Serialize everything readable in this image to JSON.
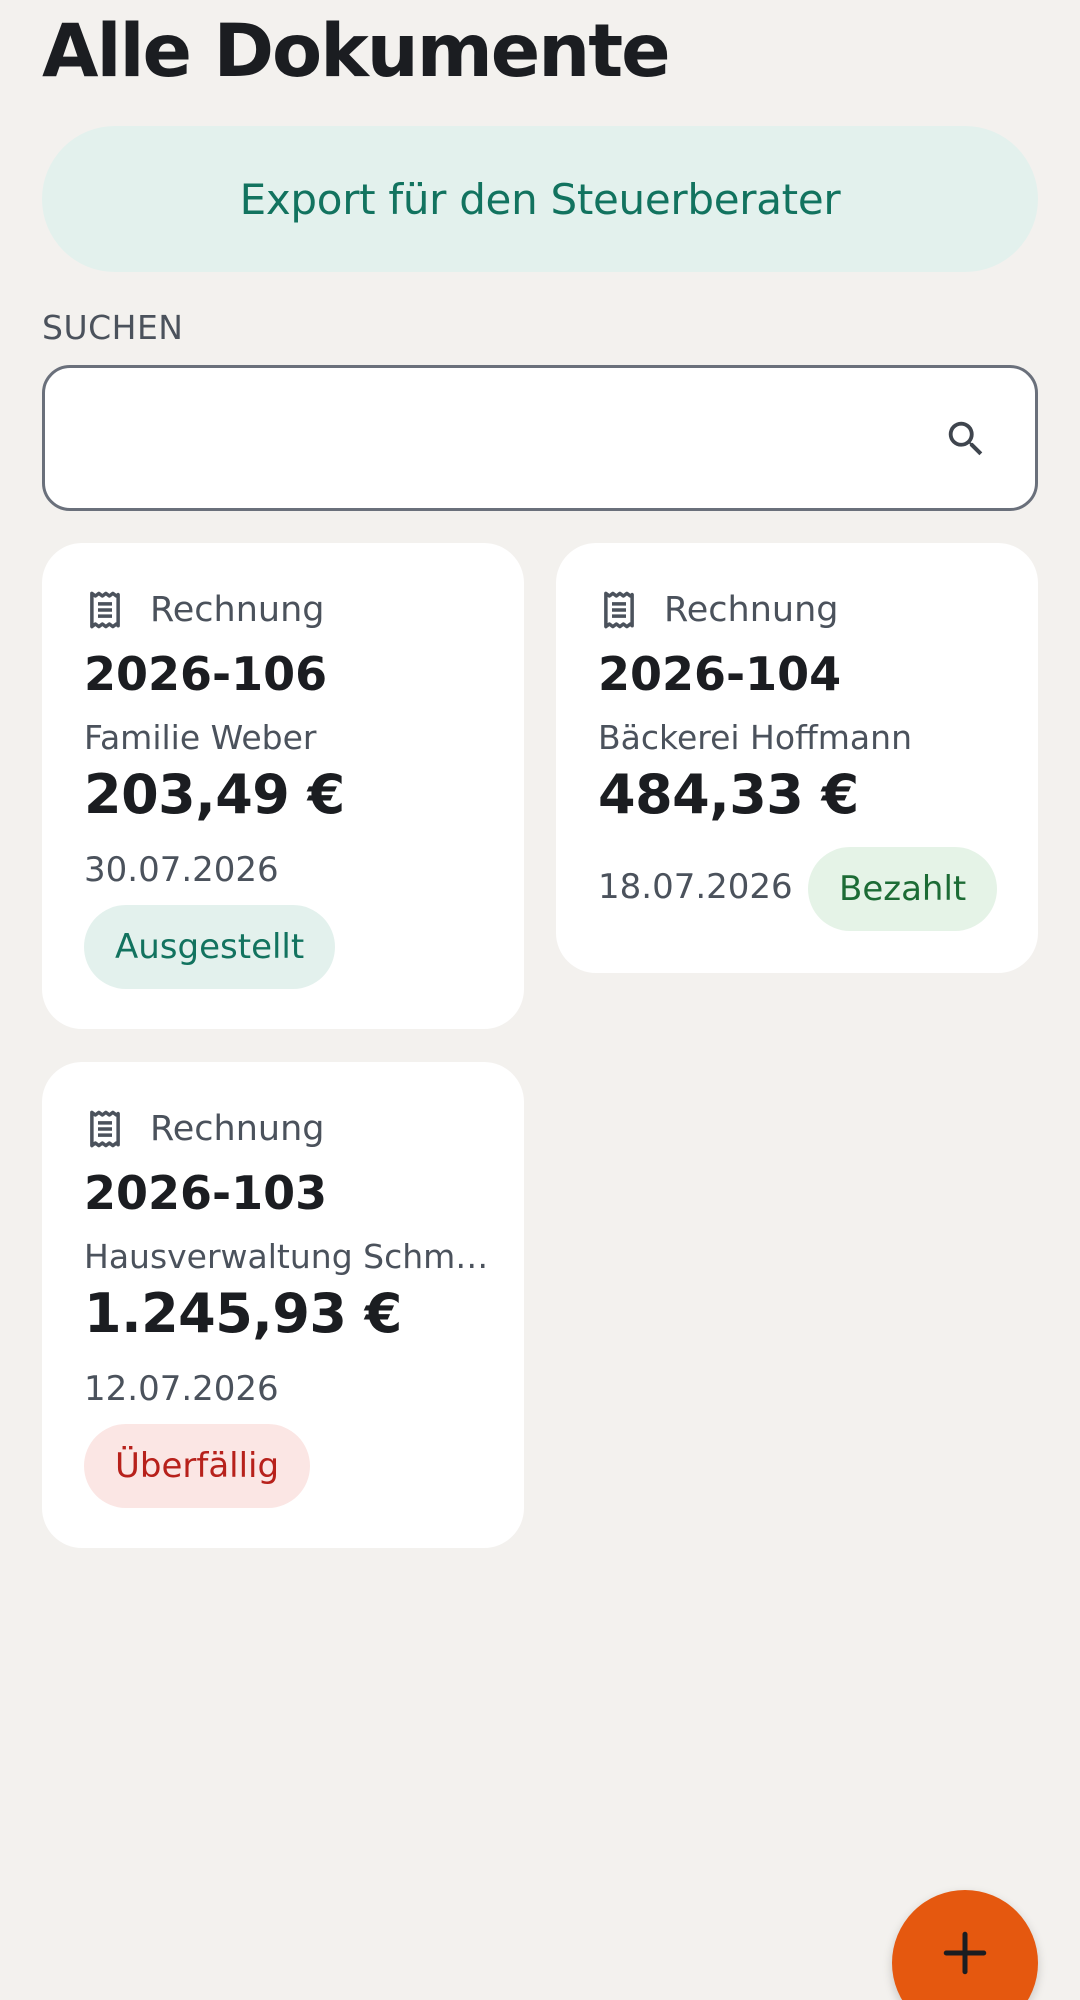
{
  "header": {
    "title": "Alle Dokumente"
  },
  "export": {
    "label": "Export für den Steuerberater"
  },
  "search": {
    "label": "SUCHEN",
    "value": "",
    "placeholder": ""
  },
  "documents": [
    {
      "type": "Rechnung",
      "number": "2026-106",
      "customer": "Familie Weber",
      "amount": "203,49 €",
      "date": "30.07.2026",
      "status": "Ausgestellt"
    },
    {
      "type": "Rechnung",
      "number": "2026-104",
      "customer": "Bäckerei Hoffmann",
      "amount": "484,33 €",
      "date": "18.07.2026",
      "status": "Bezahlt"
    },
    {
      "type": "Rechnung",
      "number": "2026-103",
      "customer": "Hausverwaltung Schm…",
      "amount": "1.245,93 €",
      "date": "12.07.2026",
      "status": "Überfällig"
    }
  ],
  "icons": {
    "search": "search-icon",
    "document": "receipt-icon",
    "add": "plus-icon"
  },
  "colors": {
    "accent": "#12735f",
    "fab": "#e5580f",
    "status_issued": "#12735f",
    "status_paid": "#1c6b35",
    "status_overdue": "#b7211b"
  }
}
